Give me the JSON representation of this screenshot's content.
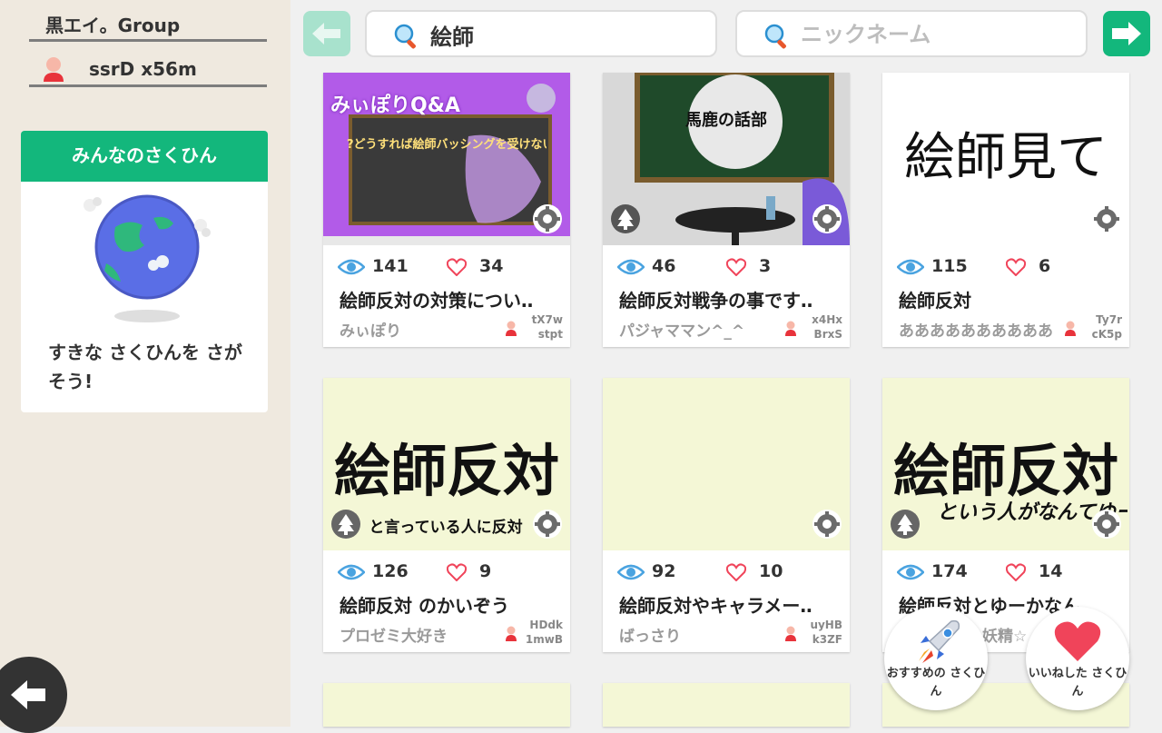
{
  "sidebar": {
    "group_name": "黒エイ。Group",
    "user_name": "ssrD x56m",
    "panel_title": "みんなのさくひん",
    "panel_desc": "すきな さくひんを さがそう!"
  },
  "search": {
    "keyword_value": "絵師",
    "nickname_placeholder": "ニックネーム"
  },
  "cards": [
    {
      "thumb_text": "みぃぽりQ&A",
      "thumb_sub": "?どうすれば絵師バッシングを受けない?",
      "views": "141",
      "likes": "34",
      "title": "絵師反対の対策につい‥",
      "author": "みぃぽり",
      "id_line1": "tX7w",
      "id_line2": "stpt"
    },
    {
      "thumb_text": "馬鹿の話部",
      "views": "46",
      "likes": "3",
      "title": "絵師反対戦争の事です‥",
      "author": "パジャママン^_^",
      "id_line1": "x4Hx",
      "id_line2": "BrxS"
    },
    {
      "thumb_text": "絵師見て",
      "views": "115",
      "likes": "6",
      "title": "絵師反対",
      "author": "ああああああああああ",
      "id_line1": "Ty7r",
      "id_line2": "cK5p"
    },
    {
      "thumb_text": "絵師反対",
      "thumb_sub": "と言っている人に反対",
      "views": "126",
      "likes": "9",
      "title": "絵師反対 のかいぞう",
      "author": "プロゼミ大好き",
      "id_line1": "HDdk",
      "id_line2": "1mwB"
    },
    {
      "views": "92",
      "likes": "10",
      "title": "絵師反対やキャラメー‥",
      "author": "ばっさり",
      "id_line1": "uyHB",
      "id_line2": "k3ZF"
    },
    {
      "thumb_text": "絵師反対",
      "thumb_sub": "という人がなんてゆーか",
      "views": "174",
      "likes": "14",
      "title": "絵師反対とゆーかなん‥",
      "author": "妖精☆"
    }
  ],
  "fabs": {
    "recommended": "おすすめの さくひん",
    "liked": "いいねした さくひん"
  },
  "colors": {
    "accent": "#13b77c",
    "sidebar_bg": "#efe9df",
    "heart": "#f0445a",
    "eye": "#4aa3e0"
  }
}
